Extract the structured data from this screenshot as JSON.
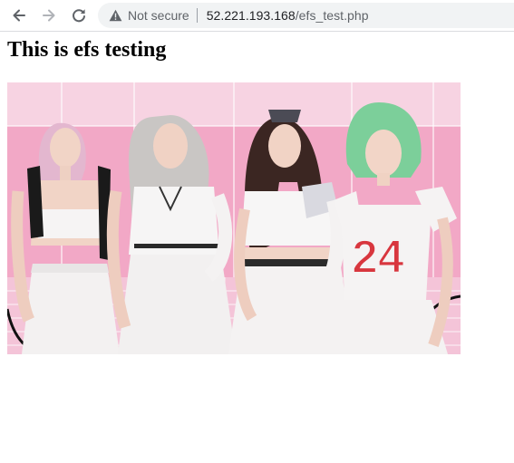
{
  "browser": {
    "security_label": "Not secure",
    "url_host": "52.221.193.168",
    "url_path": "/efs_test.php",
    "colors": {
      "omnibox_bg": "#f1f3f4",
      "icon_gray": "#5f6368"
    }
  },
  "page": {
    "heading": "This is efs testing",
    "image": {
      "colors": {
        "wall_pink": "#f2a8c6",
        "ceiling_pink": "#f7d3e2",
        "outfit_white": "#f4f2f2",
        "number_red": "#d8363e"
      },
      "jersey_number": "24"
    }
  }
}
